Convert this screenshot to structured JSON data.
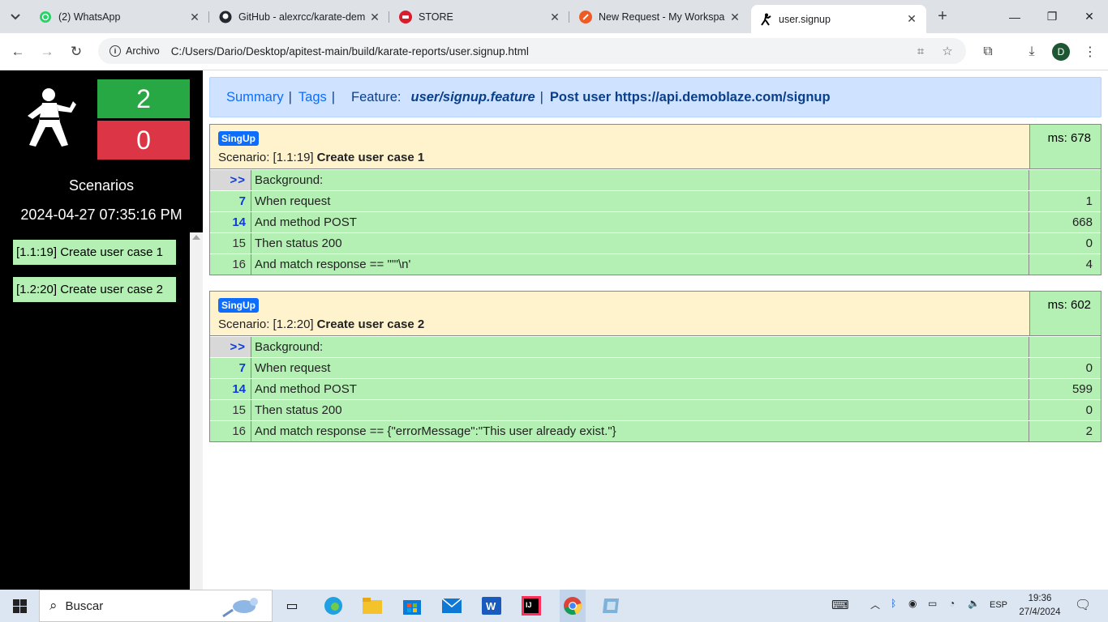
{
  "browser": {
    "tabs": [
      {
        "title": "(2) WhatsApp",
        "icon": "whatsapp-icon",
        "active": false
      },
      {
        "title": "GitHub - alexrcc/karate-dem",
        "icon": "github-icon",
        "active": false
      },
      {
        "title": "STORE",
        "icon": "store-icon",
        "active": false
      },
      {
        "title": "New Request - My Workspa",
        "icon": "postman-icon",
        "active": false
      },
      {
        "title": "user.signup",
        "icon": "karate-icon",
        "active": true
      }
    ],
    "address_chip": "Archivo",
    "url": "C:/Users/Dario/Desktop/apitest-main/build/karate-reports/user.signup.html",
    "profile_initial": "D"
  },
  "sidebar": {
    "passed": "2",
    "failed": "0",
    "label": "Scenarios",
    "date": "2024-04-27 07:35:16 PM",
    "links": [
      "[1.1:19] Create user case 1",
      "[1.2:20] Create user case 2"
    ]
  },
  "navbar": {
    "summary": "Summary",
    "tags": "Tags",
    "feature_label": "Feature:",
    "feature": "user/signup.feature",
    "description": "Post user https://api.demoblaze.com/signup"
  },
  "scenarios": [
    {
      "tag": "SingUp",
      "prefix": "Scenario: [1.1:19]",
      "name": "Create user case 1",
      "ms": "ms: 678",
      "steps": [
        {
          "line": ">>",
          "text": "Background:",
          "ms": ""
        },
        {
          "line": "7",
          "text": "When request",
          "ms": "1"
        },
        {
          "line": "14",
          "text": "And method POST",
          "ms": "668"
        },
        {
          "line": "15",
          "text": "Then status 200",
          "ms": "0"
        },
        {
          "line": "16",
          "text": "And match response == '\"\"\\n'",
          "ms": "4"
        }
      ]
    },
    {
      "tag": "SingUp",
      "prefix": "Scenario: [1.2:20]",
      "name": "Create user case 2",
      "ms": "ms: 602",
      "steps": [
        {
          "line": ">>",
          "text": "Background:",
          "ms": ""
        },
        {
          "line": "7",
          "text": "When request",
          "ms": "0"
        },
        {
          "line": "14",
          "text": "And method POST",
          "ms": "599"
        },
        {
          "line": "15",
          "text": "Then status 200",
          "ms": "0"
        },
        {
          "line": "16",
          "text": "And match response == {\"errorMessage\":\"This user already exist.\"}",
          "ms": "2"
        }
      ]
    }
  ],
  "taskbar": {
    "search_placeholder": "Buscar",
    "lang": "ESP",
    "time": "19:36",
    "date": "27/4/2024"
  }
}
